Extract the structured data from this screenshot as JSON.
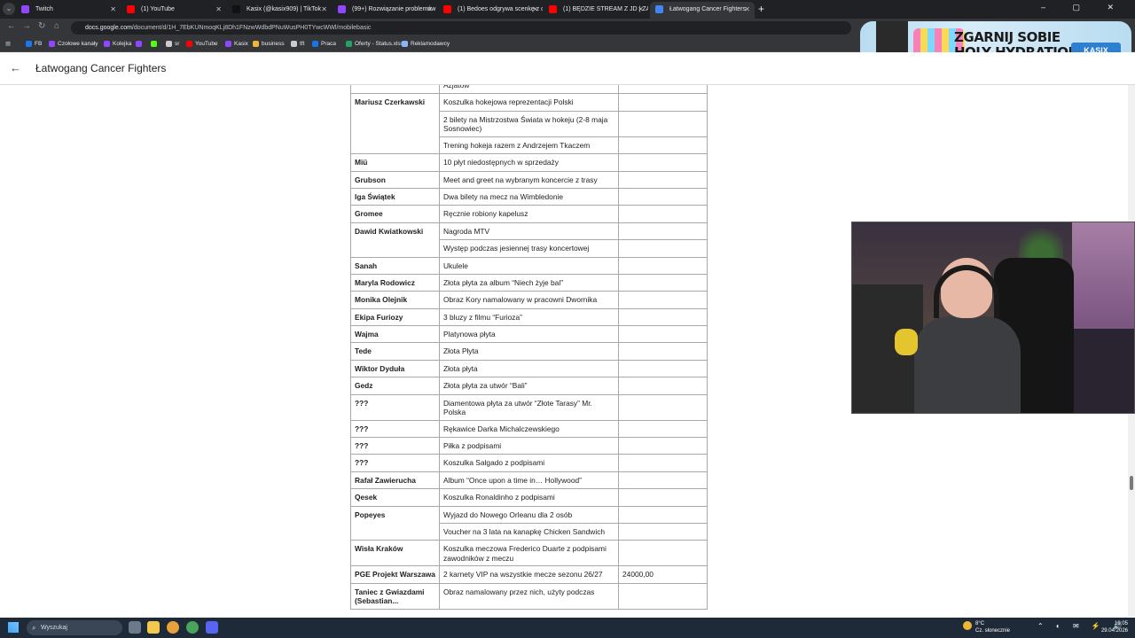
{
  "browser": {
    "tabs": [
      {
        "title": "Twitch",
        "color": "#9146ff"
      },
      {
        "title": "(1) YouTube",
        "color": "#ff0000"
      },
      {
        "title": "Kasix (@kasix909) | TikTok",
        "color": "#111111"
      },
      {
        "title": "(99+) Rozwiązanie problemów z...",
        "color": "#9146ff"
      },
      {
        "title": "(1) Bedoes odgrywa scenkę z ci...",
        "color": "#ff0000"
      },
      {
        "title": "(1) BĘDZIE STREAM Z JD | ZAGR...",
        "color": "#ff0000"
      },
      {
        "title": "Łatwogang Cancer Fighters",
        "color": "#4285f4",
        "active": true
      }
    ],
    "url_domain": "docs.google.com",
    "url_path": "/document/d/1H_7EbKUNmoqKLj8Dh1FNzwWdbdPNuWusPH0TYwcWWl/mobilebasic",
    "bookmarks": [
      {
        "label": "FB",
        "color": "#1877f2"
      },
      {
        "label": "Czołowe kanały",
        "color": "#9146ff"
      },
      {
        "label": "Kolejka",
        "color": "#9146ff"
      },
      {
        "label": "",
        "color": "#9146ff"
      },
      {
        "label": "",
        "color": "#53fc18"
      },
      {
        "label": "sr",
        "color": "#cccccc"
      },
      {
        "label": "YouTube",
        "color": "#ff0000"
      },
      {
        "label": "Kasix",
        "color": "#9146ff"
      },
      {
        "label": "business",
        "color": "#f2b533"
      },
      {
        "label": "tft",
        "color": "#cccccc"
      },
      {
        "label": "Praca",
        "color": "#1a73e8"
      },
      {
        "label": "Oferty - Status.xlsx",
        "color": "#21a366"
      },
      {
        "label": "Reklamodawcy",
        "color": "#8ab4f8"
      }
    ]
  },
  "ad": {
    "headline_line1": "ZGARNIJ SOBIE",
    "headline_line2": "HOLY HYDRATION",
    "brand": "KASIX"
  },
  "doc": {
    "title": "Łatwogang Cancer Fighters",
    "rows": [
      {
        "name": "",
        "item": "Azjatów",
        "value": "",
        "partial_top": true
      },
      {
        "name": "Mariusz Czerkawski",
        "item": "Koszulka hokejowa reprezentacji Polski",
        "value": "",
        "rowspan": 3
      },
      {
        "name": null,
        "item": "2 bilety na Mistrzostwa Świata w hokeju (2-8 maja Sosnowiec)",
        "value": ""
      },
      {
        "name": null,
        "item": "Trening hokeja razem z Andrzejem Tkaczem",
        "value": ""
      },
      {
        "name": "Miü",
        "item": "10 płyt niedostępnych w sprzedaży",
        "value": ""
      },
      {
        "name": "Grubson",
        "item": "Meet and greet na wybranym koncercie z trasy",
        "value": ""
      },
      {
        "name": "Iga Świątek",
        "item": "Dwa bilety na mecz na Wimbledonie",
        "value": ""
      },
      {
        "name": "Gromee",
        "item": "Ręcznie robiony kapelusz",
        "value": ""
      },
      {
        "name": "Dawid Kwiatkowski",
        "item": "Nagroda MTV",
        "value": "",
        "rowspan": 2
      },
      {
        "name": null,
        "item": "Występ podczas jesiennej trasy koncertowej",
        "value": ""
      },
      {
        "name": "Sanah",
        "item": "Ukulele",
        "value": ""
      },
      {
        "name": "Maryla Rodowicz",
        "item": "Złota płyta za album “Niech żyje bal”",
        "value": ""
      },
      {
        "name": "Monika Olejnik",
        "item": "Obraz Kory namalowany w pracowni Dwornika",
        "value": ""
      },
      {
        "name": "Ekipa Furiozy",
        "item": "3 bluzy z filmu “Furioza”",
        "value": ""
      },
      {
        "name": "Wajma",
        "item": "Platynowa płyta",
        "value": ""
      },
      {
        "name": "Tede",
        "item": "Złota Płyta",
        "value": ""
      },
      {
        "name": "Wiktor Dyduła",
        "item": "Złota płyta",
        "value": ""
      },
      {
        "name": "Gedz",
        "item": "Złota płyta za utwór “Bali”",
        "value": ""
      },
      {
        "name": "???",
        "item": "Diamentowa płyta za utwór “Złote Tarasy” Mr. Polska",
        "value": ""
      },
      {
        "name": "???",
        "item": "Rękawice Darka Michalczewskiego",
        "value": ""
      },
      {
        "name": "???",
        "item": "Piłka z podpisami",
        "value": ""
      },
      {
        "name": "???",
        "item": "Koszulka Salgado z podpisami",
        "value": ""
      },
      {
        "name": "Rafał Zawierucha",
        "item": "Album “Once upon a time in… Hollywood”",
        "value": ""
      },
      {
        "name": "Qesek",
        "item": "Koszulka Ronaldinho z podpisami",
        "value": ""
      },
      {
        "name": "Popeyes",
        "item": "Wyjazd do Nowego Orleanu dla 2 osób",
        "value": "",
        "rowspan": 2
      },
      {
        "name": null,
        "item": "Voucher na 3 lata na kanapkę Chicken Sandwich",
        "value": ""
      },
      {
        "name": "Wisła Kraków",
        "item": "Koszulka meczowa Frederico Duarte z podpisami zawodników z meczu",
        "value": ""
      },
      {
        "name": "PGE Projekt Warszawa",
        "item": "2 karnety VIP na wszystkie mecze sezonu 26/27",
        "value": "24000,00"
      },
      {
        "name": "Taniec z Gwiazdami (Sebastian...",
        "item": "Obraz namalowany przez nich, użyty podczas",
        "value": ""
      }
    ]
  },
  "taskbar": {
    "search_placeholder": "Wyszukaj",
    "weather_temp": "8°C",
    "weather_desc": "Cz. słonecznie",
    "time": "19:05",
    "date": "29.04.2026"
  }
}
